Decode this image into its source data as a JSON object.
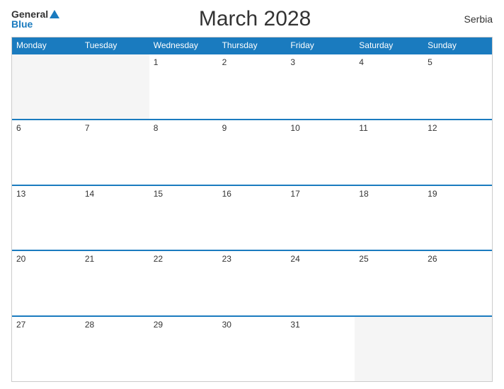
{
  "header": {
    "logo_general": "General",
    "logo_blue": "Blue",
    "title": "March 2028",
    "country": "Serbia"
  },
  "calendar": {
    "days": [
      "Monday",
      "Tuesday",
      "Wednesday",
      "Thursday",
      "Friday",
      "Saturday",
      "Sunday"
    ],
    "weeks": [
      [
        {
          "day": "",
          "empty": true
        },
        {
          "day": "",
          "empty": true
        },
        {
          "day": "1",
          "empty": false
        },
        {
          "day": "2",
          "empty": false
        },
        {
          "day": "3",
          "empty": false
        },
        {
          "day": "4",
          "empty": false
        },
        {
          "day": "5",
          "empty": false
        }
      ],
      [
        {
          "day": "6",
          "empty": false
        },
        {
          "day": "7",
          "empty": false
        },
        {
          "day": "8",
          "empty": false
        },
        {
          "day": "9",
          "empty": false
        },
        {
          "day": "10",
          "empty": false
        },
        {
          "day": "11",
          "empty": false
        },
        {
          "day": "12",
          "empty": false
        }
      ],
      [
        {
          "day": "13",
          "empty": false
        },
        {
          "day": "14",
          "empty": false
        },
        {
          "day": "15",
          "empty": false
        },
        {
          "day": "16",
          "empty": false
        },
        {
          "day": "17",
          "empty": false
        },
        {
          "day": "18",
          "empty": false
        },
        {
          "day": "19",
          "empty": false
        }
      ],
      [
        {
          "day": "20",
          "empty": false
        },
        {
          "day": "21",
          "empty": false
        },
        {
          "day": "22",
          "empty": false
        },
        {
          "day": "23",
          "empty": false
        },
        {
          "day": "24",
          "empty": false
        },
        {
          "day": "25",
          "empty": false
        },
        {
          "day": "26",
          "empty": false
        }
      ],
      [
        {
          "day": "27",
          "empty": false
        },
        {
          "day": "28",
          "empty": false
        },
        {
          "day": "29",
          "empty": false
        },
        {
          "day": "30",
          "empty": false
        },
        {
          "day": "31",
          "empty": false
        },
        {
          "day": "",
          "empty": true
        },
        {
          "day": "",
          "empty": true
        }
      ]
    ]
  }
}
